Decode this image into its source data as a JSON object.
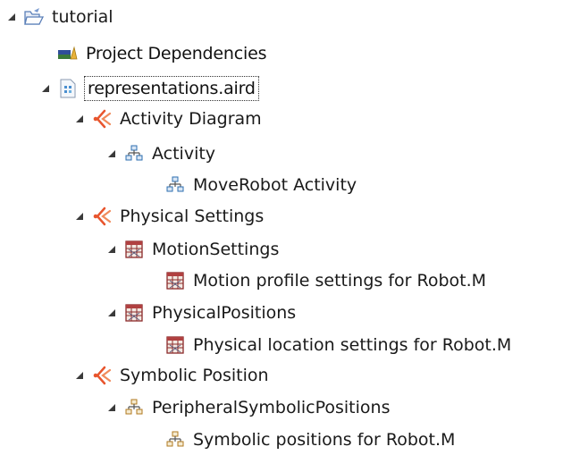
{
  "tree": {
    "root": {
      "label": "tutorial",
      "icon": "folder-open-icon"
    },
    "project_dependencies": {
      "label": "Project Dependencies",
      "icon": "library-icon"
    },
    "representations": {
      "label": "representations.aird",
      "icon": "aird-file-icon"
    },
    "activity_diagram": {
      "label": "Activity Diagram",
      "icon": "viewpoint-icon"
    },
    "activity": {
      "label": "Activity",
      "icon": "diagram-tree-icon"
    },
    "moverobot": {
      "label": "MoveRobot Activity",
      "icon": "diagram-tree-icon"
    },
    "physical_settings": {
      "label": "Physical Settings",
      "icon": "viewpoint-icon"
    },
    "motion_settings": {
      "label": "MotionSettings",
      "icon": "table-icon"
    },
    "motion_profile": {
      "label": "Motion profile settings for Robot.M",
      "icon": "table-icon"
    },
    "physical_positions": {
      "label": "PhysicalPositions",
      "icon": "table-icon"
    },
    "physical_location": {
      "label": "Physical location settings for Robot.M",
      "icon": "table-icon"
    },
    "symbolic_position": {
      "label": "Symbolic Position",
      "icon": "viewpoint-icon"
    },
    "peripheral": {
      "label": "PeripheralSymbolicPositions",
      "icon": "diagram-tree-icon"
    },
    "symbolic_positions": {
      "label": "Symbolic positions for Robot.M",
      "icon": "diagram-tree-icon"
    }
  },
  "colors": {
    "viewpoint": "#e8552d",
    "table_border": "#8b2a2a",
    "diagram": "#2d6fb0",
    "folder": "#4a78c8"
  }
}
